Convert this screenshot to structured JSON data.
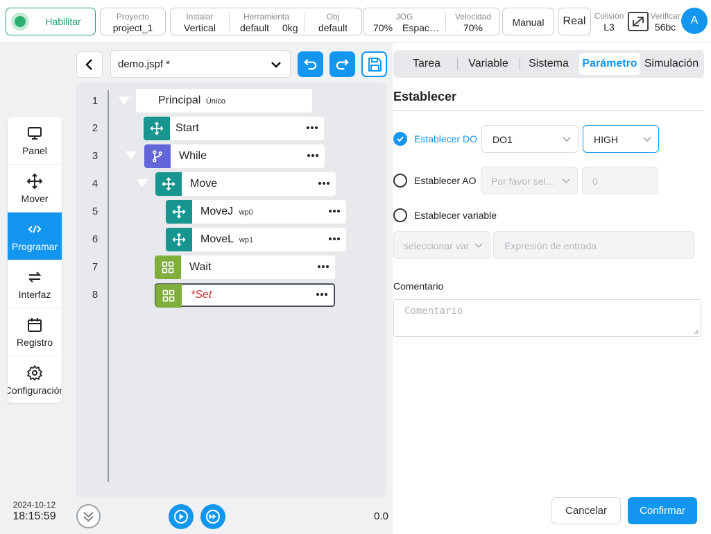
{
  "topbar": {
    "enable_label": "Habilitar",
    "project": {
      "label": "Proyecto",
      "value": "project_1"
    },
    "install": {
      "label": "Instalar",
      "value": "Vertical"
    },
    "tool": {
      "label": "Herramienta",
      "value_name": "default",
      "value_weight": "0kg"
    },
    "obj": {
      "label": "Obj",
      "value": "default"
    },
    "jog": {
      "label": "JOG",
      "value_speed": "70%",
      "value_space": "Espac…"
    },
    "velocity": {
      "label": "Velocidad",
      "value": "70%"
    },
    "mode": "Manual",
    "real": "Real",
    "collision": {
      "label": "Colisión",
      "value": "L3"
    },
    "verify": {
      "label": "Verificar",
      "value": "56bc"
    },
    "avatar": "A",
    "accent_color": "#1296f0",
    "enable_color": "#27a36c"
  },
  "nav": {
    "items": [
      {
        "label": "Panel",
        "icon": "monitor-icon"
      },
      {
        "label": "Mover",
        "icon": "move-icon"
      },
      {
        "label": "Programar",
        "icon": "code-icon",
        "active": true
      },
      {
        "label": "Interfaz",
        "icon": "swap-icon"
      },
      {
        "label": "Registro",
        "icon": "calendar-icon"
      },
      {
        "label": "Configuración",
        "icon": "gear-icon"
      }
    ],
    "date": "2024-10-12",
    "time": "18:15:59"
  },
  "editor": {
    "file_name": "demo.jspf *",
    "line_numbers": [
      "1",
      "2",
      "3",
      "4",
      "5",
      "6",
      "7",
      "8"
    ],
    "principal": {
      "label": "Principal",
      "sub": "Único"
    },
    "nodes": [
      {
        "label": "Start",
        "sub": "",
        "icon": "move-icon",
        "color": "#18958e"
      },
      {
        "label": "While",
        "sub": "",
        "icon": "branch-icon",
        "color": "#6366d8"
      },
      {
        "label": "Move",
        "sub": "",
        "icon": "move-icon",
        "color": "#18958e"
      },
      {
        "label": "MoveJ",
        "sub": "wp0",
        "icon": "move-icon",
        "color": "#18958e"
      },
      {
        "label": "MoveL",
        "sub": "wp1",
        "icon": "move-icon",
        "color": "#18958e"
      },
      {
        "label": "Wait",
        "sub": "",
        "icon": "grid-icon",
        "color": "#7fae3d"
      },
      {
        "label": "*Set",
        "sub": "",
        "icon": "grid-icon",
        "color": "#7fae3d",
        "selected": true,
        "text_color": "#d32f2f"
      }
    ],
    "speed_value": "0.0"
  },
  "tabs": {
    "items": [
      "Tarea",
      "Variable",
      "Sistema",
      "Parámetro",
      "Simulación"
    ],
    "active": "Parámetro"
  },
  "form": {
    "title": "Establecer",
    "set_do": {
      "label": "Establecer DO",
      "checked": true,
      "port": "DO1",
      "level": "HIGH"
    },
    "set_ao": {
      "label": "Establecer AO",
      "checked": false,
      "placeholder": "Por favor sel…",
      "value": "0"
    },
    "set_var": {
      "label": "Establecer variable",
      "checked": false,
      "select_placeholder": "seleccionar var",
      "expr_placeholder": "Expresión de entrada"
    },
    "comment_label": "Comentario",
    "comment_placeholder": "Comentario",
    "cancel": "Cancelar",
    "confirm": "Confirmar"
  }
}
